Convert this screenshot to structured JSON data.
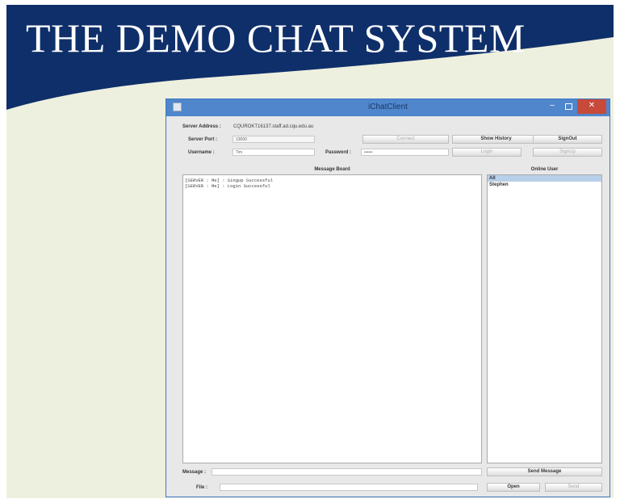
{
  "slide": {
    "title": "THE DEMO CHAT SYSTEM",
    "colors": {
      "banner": "#0f2f6a",
      "background": "#eef0df"
    }
  },
  "window": {
    "title": "iChatClient",
    "controls": {
      "minimize": "–",
      "close": "✕"
    },
    "server_address": {
      "label": "Server Address :",
      "value": "CQUROKT16137.staff.ad.cqu.edu.au"
    },
    "server_port": {
      "label": "Server Port :",
      "value": "13000"
    },
    "username": {
      "label": "Username :",
      "value": "Tim"
    },
    "password": {
      "label": "Password :",
      "value": "••••••"
    },
    "buttons": {
      "connect": "Connect",
      "show_history": "Show History",
      "signout": "SignOut",
      "login": "Login",
      "signup": "SignUp",
      "send_message": "Send Message",
      "open": "Open",
      "send": "Send"
    },
    "message_board": {
      "title": "Message Board",
      "lines": [
        "[SERVER : Me] : Singup Successful",
        "[SERVER : Me] : Login Successful"
      ]
    },
    "online_users": {
      "title": "Online User",
      "items": [
        "All",
        "Stephen"
      ],
      "selected": "All"
    },
    "message": {
      "label": "Message :",
      "value": ""
    },
    "file": {
      "label": "File :",
      "value": ""
    }
  }
}
